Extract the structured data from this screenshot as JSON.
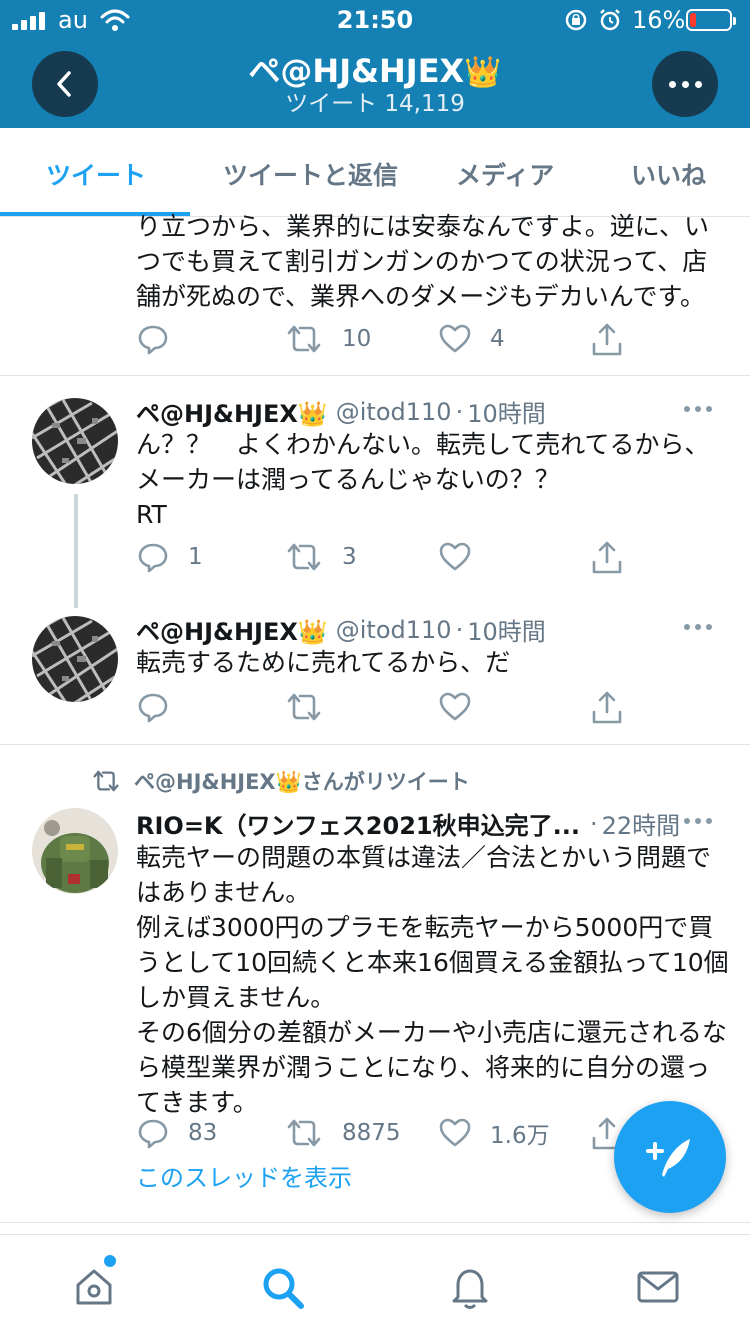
{
  "status_bar": {
    "carrier": "au",
    "time": "21:50",
    "battery_percent": "16%",
    "battery_level": 0.16,
    "battery_color": "#ff3b30"
  },
  "header": {
    "name": "ペ@HJ&HJEX",
    "name_emoji": "👑",
    "tweet_count": "ツイート 14,119",
    "background_color": "#1480b4",
    "back_icon": "chevron-left-icon",
    "more_icon": "more-horizontal-icon"
  },
  "tabs": [
    {
      "label": "ツイート",
      "active": true
    },
    {
      "label": "ツイートと返信",
      "active": false
    },
    {
      "label": "メディア",
      "active": false
    },
    {
      "label": "いいね",
      "active": false
    }
  ],
  "accent_color": "#1da1f2",
  "tweets": [
    {
      "text": "り立つから、業界的には安泰なんですよ。逆に、い\nつでも買えて割引ガンガンのかつての状況って、店\n舗が死ぬので、業界へのダメージもデカいんです。",
      "replies": "",
      "retweets": "10",
      "likes": "4"
    },
    {
      "name": "ペ@HJ&HJEX👑",
      "handle": "@itod110",
      "sep": "·",
      "time": "10時間",
      "text": "ん？？　よくわかんない。転売して売れてるから、\nメーカーは潤ってるんじゃないの？？\nRT",
      "replies": "1",
      "retweets": "3",
      "likes": ""
    },
    {
      "name": "ペ@HJ&HJEX👑",
      "handle": "@itod110",
      "sep": "·",
      "time": "10時間",
      "text": "転売するために売れてるから、だ",
      "replies": "",
      "retweets": "",
      "likes": ""
    },
    {
      "retweeted_by": "ペ@HJ&HJEX👑さんがリツイート",
      "name": "RIO=K（ワンフェス2021秋申込完了...",
      "sep": "·",
      "time": "22時間",
      "text": "転売ヤーの問題の本質は違法／合法とかいう問題で\nはありません。\n例えば3000円のプラモを転売ヤーから5000円で買\nうとして10回続くと本来16個買える金額払って10個\nしか買えません。\nその6個分の差額がメーカーや小売店に還元されるな\nら模型業界が潤うことになり、将来的に自分の還っ\nてきます。",
      "replies": "83",
      "retweets": "8875",
      "likes": "1.6万",
      "show_thread": "このスレッドを表示"
    }
  ],
  "bottom_nav": [
    {
      "icon": "home-icon",
      "has_notification": true
    },
    {
      "icon": "search-icon",
      "active": true
    },
    {
      "icon": "notifications-bell-icon"
    },
    {
      "icon": "messages-mail-icon"
    }
  ],
  "fab": {
    "icon": "compose-tweet-icon"
  }
}
